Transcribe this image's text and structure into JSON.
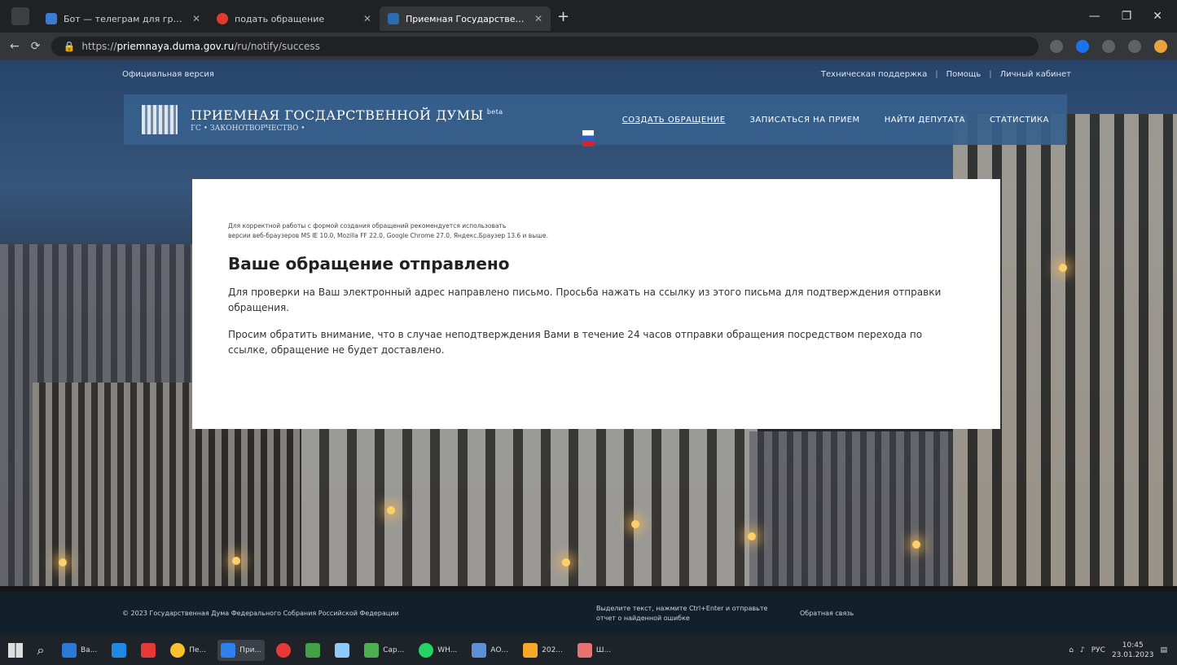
{
  "browser": {
    "tabs": [
      {
        "title": "Бот — телеграм для групп",
        "color": "#3a7bd5",
        "active": false
      },
      {
        "title": "подать обращение",
        "color": "#e03a2e",
        "active": false
      },
      {
        "title": "Приемная Государственной Д",
        "color": "#2b6cb0",
        "active": true
      }
    ],
    "new_tab": "+",
    "address": {
      "prefix": "https://",
      "domain": "priemnaya.duma.gov.ru",
      "path": "/ru/notify/success"
    },
    "window_controls": [
      "—",
      "❐",
      "✕"
    ]
  },
  "site": {
    "accessibility_link": "Официальная версия",
    "top_links": [
      "Техническая поддержка",
      "Помощь",
      "Личный кабинет"
    ],
    "logo": {
      "title": "ПРИЕМНАЯ ГОСДАРСТВЕННОЙ ДУМЫ",
      "beta": "beta",
      "subtitle": "ГС • ЗАКОНОТВОРЧЕСТВО •"
    },
    "nav": [
      {
        "label": "СОЗДАТЬ ОБРАЩЕНИЕ",
        "active": true
      },
      {
        "label": "ЗАПИСАТЬСЯ НА ПРИЕМ",
        "active": false
      },
      {
        "label": "НАЙТИ ДЕПУТАТА",
        "active": false
      },
      {
        "label": "СТАТИСТИКА",
        "active": false
      }
    ],
    "card": {
      "browser_note_1": "Для корректной работы с формой создания обращений рекомендуется использовать",
      "browser_note_2": "версии веб-браузеров MS IE 10.0, Mozilla FF 22.0, Google Chrome 27.0, Яндекс.Браузер 13.6 и выше.",
      "title": "Ваше обращение отправлено",
      "paragraph_1": "Для проверки на Ваш электронный адрес направлено письмо. Просьба нажать на ссылку из этого письма для подтверждения отправки обращения.",
      "paragraph_2": "Просим обратить внимание, что в случае неподтверждения Вами в течение 24 часов отправки обращения посредством перехода по ссылке, обращение не будет доставлено."
    },
    "footer": {
      "copyright": "© 2023 Государственная Дума Федерального Собрания Российской Федерации",
      "error_report": "Выделите текст, нажмите Ctrl+Enter и отправьте отчет о найденной ошибке",
      "feedback": "Обратная связь"
    }
  },
  "taskbar": {
    "apps": [
      {
        "label": "Ва...",
        "color": "#2b79d6"
      },
      {
        "label": "",
        "color": "#1e88e5"
      },
      {
        "label": "",
        "color": "#e53935"
      },
      {
        "label": "Пе...",
        "color": "#fbc02d"
      },
      {
        "label": "При...",
        "color": "#2f80ed",
        "active": true
      },
      {
        "label": "",
        "color": "#e53935"
      },
      {
        "label": "",
        "color": "#43a047"
      },
      {
        "label": "",
        "color": "#90caf9"
      },
      {
        "label": "Сар...",
        "color": "#4caf50"
      },
      {
        "label": "WH...",
        "color": "#25d366"
      },
      {
        "label": "АО...",
        "color": "#5c8fd6"
      },
      {
        "label": "202...",
        "color": "#f9a825"
      },
      {
        "label": "Ш...",
        "color": "#e57373"
      }
    ],
    "tray_lang": "РУС",
    "time": "10:45",
    "date": "23.01.2023"
  }
}
